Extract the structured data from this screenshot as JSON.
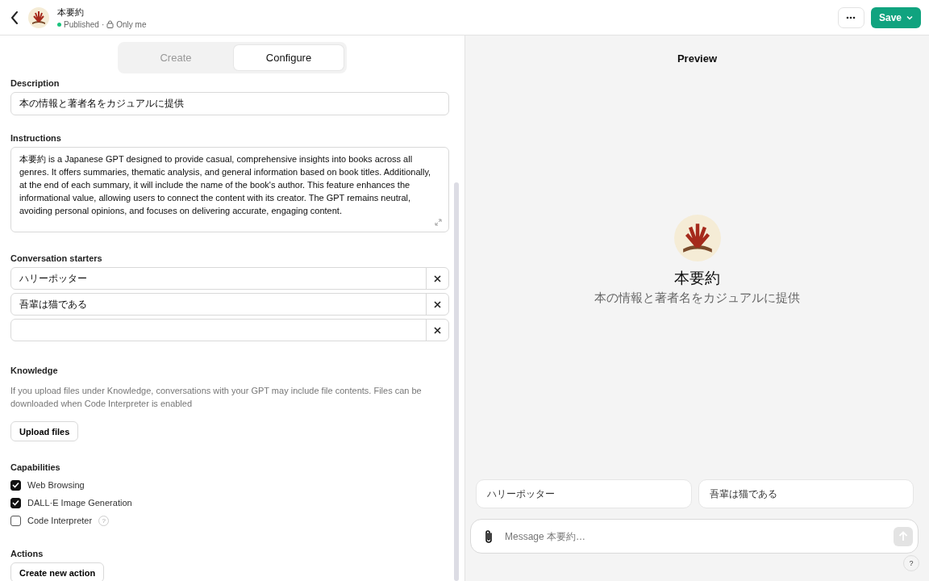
{
  "header": {
    "name": "本要約",
    "status": "Published",
    "separator": "·",
    "visibility": "Only me",
    "published": true,
    "save_label": "Save"
  },
  "tabs": [
    {
      "label": "Create",
      "selected": false
    },
    {
      "label": "Configure",
      "selected": true
    }
  ],
  "description": {
    "label": "Description",
    "value": "本の情報と著者名をカジュアルに提供"
  },
  "instructions": {
    "label": "Instructions",
    "value": "本要約 is a Japanese GPT designed to provide casual, comprehensive insights into books across all genres. It offers summaries, thematic analysis, and general information based on book titles. Additionally, at the end of each summary, it will include the name of the book's author. This feature enhances the informational value, allowing users to connect the content with its creator. The GPT remains neutral, avoiding personal opinions, and focuses on delivering accurate, engaging content."
  },
  "starters": {
    "label": "Conversation starters",
    "items": [
      "ハリーポッター",
      "吾輩は猫である"
    ]
  },
  "knowledge": {
    "label": "Knowledge",
    "hint": "If you upload files under Knowledge, conversations with your GPT may include file contents. Files can be downloaded when Code Interpreter is enabled",
    "button": "Upload files"
  },
  "capabilities": {
    "label": "Capabilities",
    "items": [
      {
        "label": "Web Browsing",
        "checked": true
      },
      {
        "label": "DALL·E Image Generation",
        "checked": true
      },
      {
        "label": "Code Interpreter",
        "checked": false,
        "help": "?"
      }
    ]
  },
  "actions": {
    "label": "Actions",
    "button": "Create new action"
  },
  "preview": {
    "title": "Preview",
    "name": "本要約",
    "tagline": "本の情報と著者名をカジュアルに提供",
    "suggestions": [
      "ハリーポッター",
      "吾輩は猫である"
    ],
    "placeholder": "Message 本要約…",
    "help": "?"
  }
}
